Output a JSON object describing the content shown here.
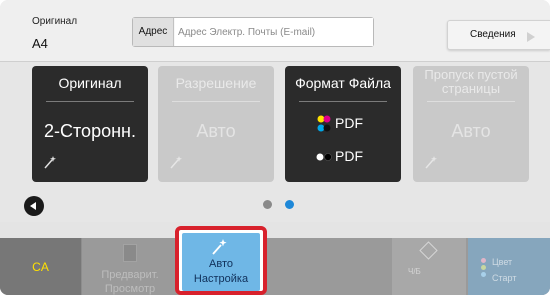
{
  "header": {
    "original_caption": "Оригинал",
    "original_value": "A4",
    "address_label": "Адрес",
    "address_placeholder": "Адрес Электр. Почты (E-mail)",
    "info_label": "Сведения"
  },
  "tiles": [
    {
      "title": "Оригинал",
      "value": "2-Сторонн.",
      "state": "active"
    },
    {
      "title": "Разрешение",
      "value": "Авто",
      "state": "disabled"
    },
    {
      "title": "Формат Файла",
      "color_format": "PDF",
      "mono_format": "PDF",
      "state": "active"
    },
    {
      "title": "Пропуск пустой страницы",
      "value": "Авто",
      "state": "disabled"
    }
  ],
  "pager": {
    "current_page": 2,
    "total_pages": 2
  },
  "bottom_bar": {
    "ca_label": "CA",
    "preview_label": "Предварит. Просмотр",
    "auto_label": "Авто Настройка",
    "bw_label": "Ч/Б",
    "color_label_1": "Цвет",
    "color_label_2": "Старт"
  },
  "colors": {
    "accent_blue": "#6fb7e6",
    "highlight_red": "#d8212c",
    "ca_yellow": "#ffe000",
    "active_tile": "#2b2b2b",
    "dot_active": "#1e88d8",
    "dot_inactive": "#8a8a8a"
  }
}
